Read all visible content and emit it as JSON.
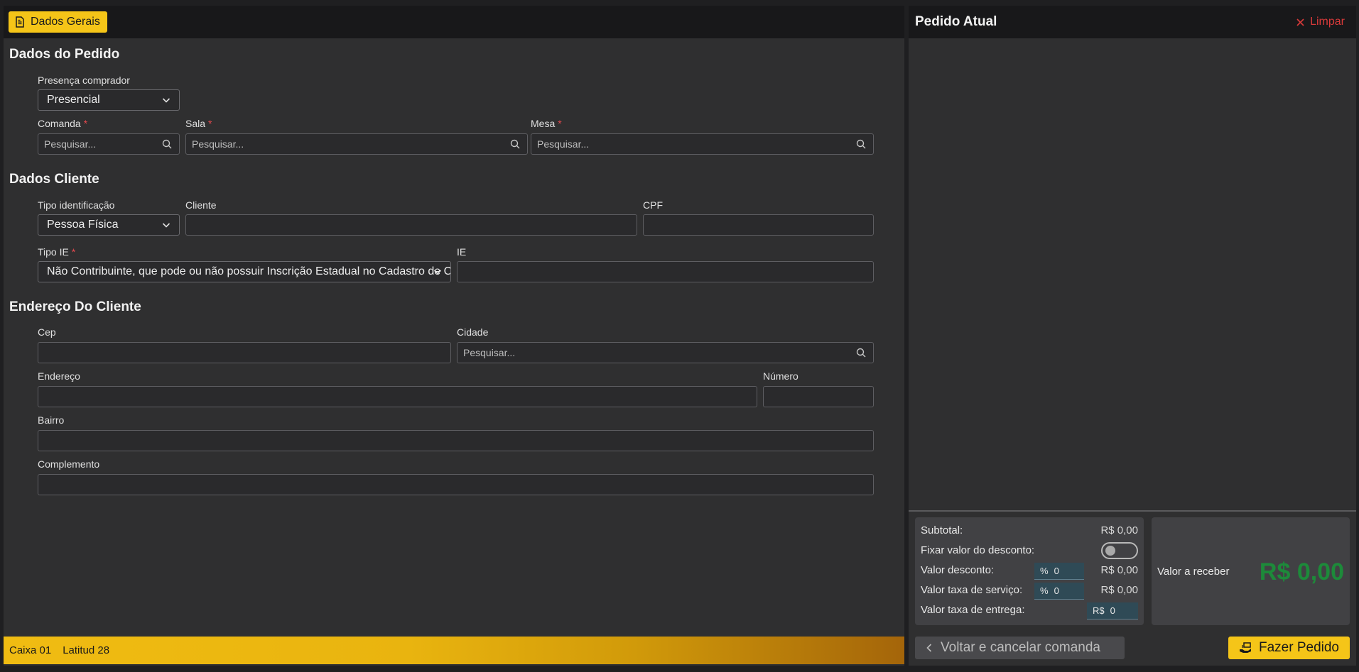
{
  "left": {
    "tab_label": "Dados Gerais",
    "sections": {
      "pedido": "Dados do Pedido",
      "cliente": "Dados Cliente",
      "endereco": "Endereço Do Cliente"
    },
    "fields": {
      "presenca_label": "Presença comprador",
      "presenca_value": "Presencial",
      "comanda_label": "Comanda",
      "sala_label": "Sala",
      "mesa_label": "Mesa",
      "search_placeholder": "Pesquisar...",
      "required_mark": "*",
      "tipo_ident_label": "Tipo identificação",
      "tipo_ident_value": "Pessoa Física",
      "cliente_label": "Cliente",
      "cpf_label": "CPF",
      "tipo_ie_label": "Tipo IE",
      "tipo_ie_value": "Não Contribuinte, que pode ou não possuir Inscrição Estadual no Cadastro de Contribuintes",
      "ie_label": "IE",
      "cep_label": "Cep",
      "cidade_label": "Cidade",
      "endereco_label": "Endereço",
      "numero_label": "Número",
      "bairro_label": "Bairro",
      "complemento_label": "Complemento"
    },
    "footer": {
      "caixa": "Caixa 01",
      "latitud": "Latitud 28"
    }
  },
  "right": {
    "title": "Pedido Atual",
    "clear_label": "Limpar",
    "totals": {
      "subtotal_label": "Subtotal:",
      "subtotal_value": "R$ 0,00",
      "fixar_label": "Fixar valor do desconto:",
      "desconto_label": "Valor desconto:",
      "desconto_prefix": "%",
      "desconto_input": "0",
      "desconto_value": "R$ 0,00",
      "taxa_servico_label": "Valor taxa de serviço:",
      "taxa_servico_prefix": "%",
      "taxa_servico_input": "0",
      "taxa_servico_value": "R$ 0,00",
      "taxa_entrega_label": "Valor taxa de entrega:",
      "taxa_entrega_prefix": "R$",
      "taxa_entrega_input": "0"
    },
    "receber": {
      "label": "Valor a receber",
      "amount": "R$ 0,00"
    },
    "back_button": "Voltar e cancelar comanda",
    "order_button": "Fazer Pedido"
  },
  "colors": {
    "accent": "#f5c518",
    "danger": "#d93a3a",
    "success": "#1d8a3a"
  }
}
